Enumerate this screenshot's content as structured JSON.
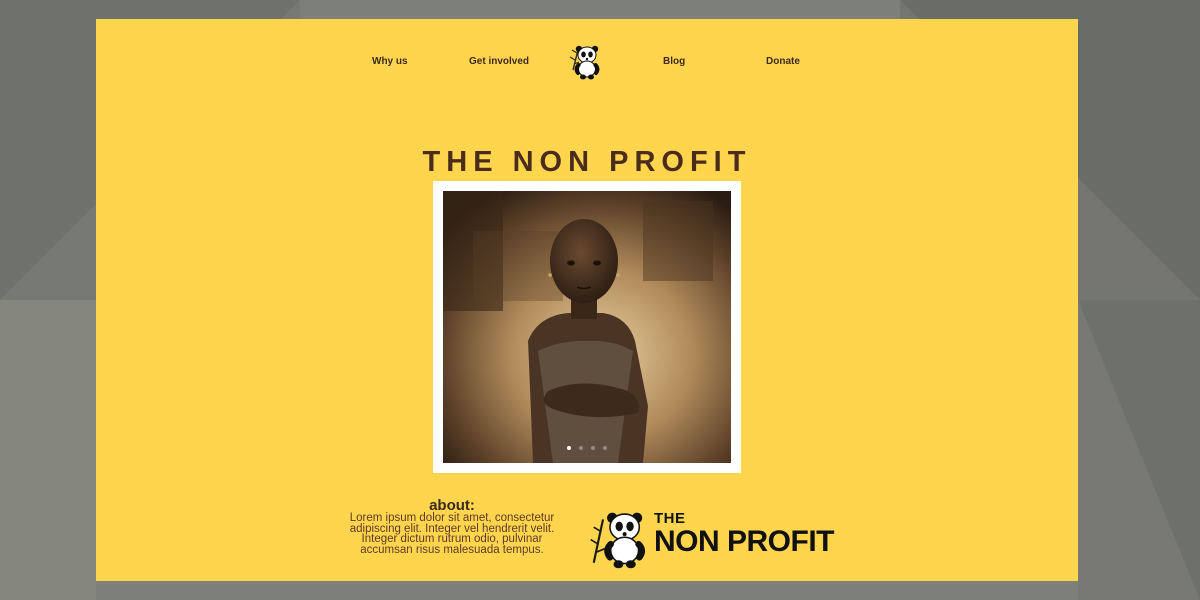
{
  "nav": {
    "items": [
      {
        "label": "Why us"
      },
      {
        "label": "Get involved"
      },
      {
        "label": "Blog"
      },
      {
        "label": "Donate"
      }
    ],
    "logo_icon": "panda-bamboo-icon"
  },
  "hero": {
    "title": "THE NON PROFIT",
    "slider": {
      "slide_count": 4,
      "active_slide": 1
    }
  },
  "about": {
    "heading": "about:",
    "lines": [
      "Lorem ipsum dolor sit amet, consectetur",
      "adipiscing elit. Integer vel hendrerit velit.",
      "Integer dictum rutrum odio, pulvinar",
      "accumsan risus malesuada tempus."
    ]
  },
  "brand": {
    "the": "THE",
    "name": "NON PROFIT",
    "icon": "panda-bamboo-icon"
  },
  "colors": {
    "card_background": "#ffd54e",
    "page_background": "#7d7f79",
    "title_text": "#4a2c1c"
  }
}
